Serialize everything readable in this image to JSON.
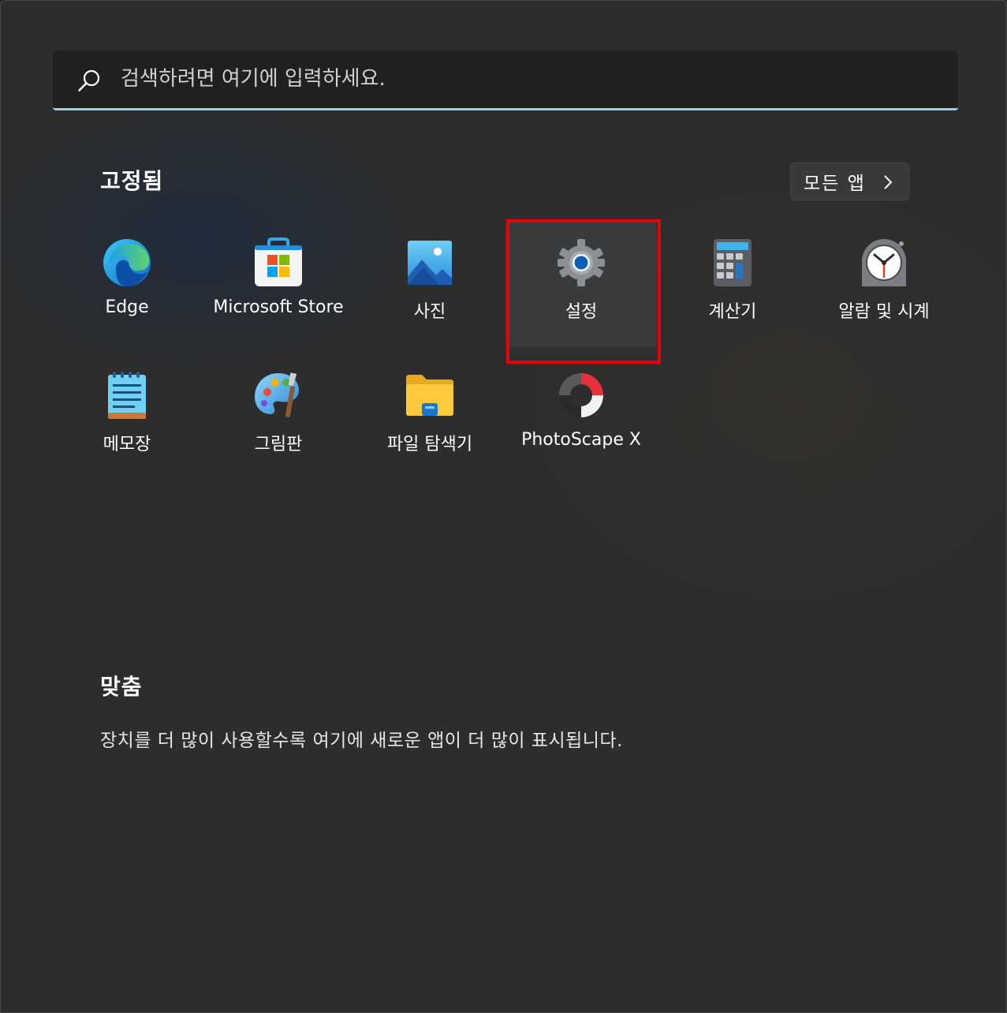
{
  "search": {
    "placeholder": "검색하려면 여기에 입력하세요."
  },
  "pinned": {
    "title": "고정됨",
    "all_apps_label": "모든 앱",
    "apps": [
      {
        "label": "Edge",
        "icon": "edge-icon"
      },
      {
        "label": "Microsoft Store",
        "icon": "microsoft-store-icon"
      },
      {
        "label": "사진",
        "icon": "photos-icon"
      },
      {
        "label": "설정",
        "icon": "settings-gear-icon",
        "selected": true
      },
      {
        "label": "계산기",
        "icon": "calculator-icon"
      },
      {
        "label": "알람 및 시계",
        "icon": "alarm-clock-icon"
      },
      {
        "label": "메모장",
        "icon": "notepad-icon"
      },
      {
        "label": "그림판",
        "icon": "paint-palette-icon"
      },
      {
        "label": "파일 탐색기",
        "icon": "file-explorer-folder-icon"
      },
      {
        "label": "PhotoScape X",
        "icon": "photoscape-x-icon"
      }
    ]
  },
  "recommended": {
    "title": "맞춤",
    "message": "장치를 더 많이 사용할수록 여기에 새로운 앱이 더 많이 표시됩니다."
  },
  "colors": {
    "accent": "#9ccbe8",
    "highlight": "#e8000b",
    "background": "#2d2d2d"
  }
}
